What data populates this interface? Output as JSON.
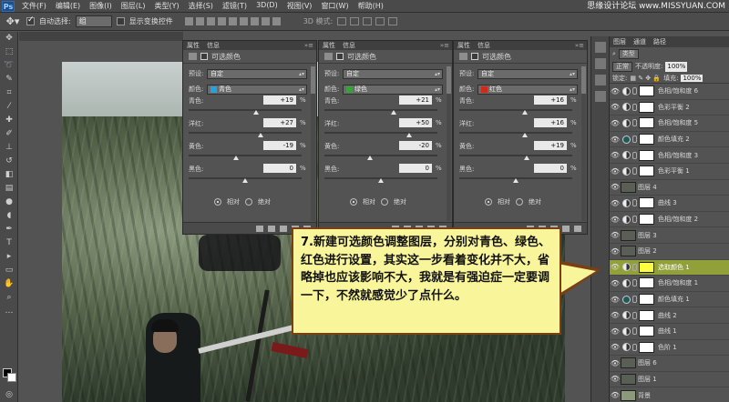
{
  "app": {
    "logo": "Ps",
    "menu": [
      "文件(F)",
      "编辑(E)",
      "图像(I)",
      "图层(L)",
      "类型(Y)",
      "选择(S)",
      "滤镜(T)",
      "3D(D)",
      "视图(V)",
      "窗口(W)",
      "帮助(H)"
    ],
    "watermark": "思缘设计论坛 www.MISSYUAN.COM"
  },
  "options": {
    "auto_select_label": "自动选择:",
    "auto_select_value": "组",
    "show_transform_label": "显示变换控件",
    "mode3d_label": "3D 模式:"
  },
  "panels": [
    {
      "tabs": [
        "属性",
        "信息"
      ],
      "title": "可选颜色",
      "preset_label": "预设:",
      "preset_value": "自定",
      "color_label": "颜色:",
      "color_value": "青色",
      "color_chip": "#27a0e0",
      "sliders": [
        {
          "label": "青色:",
          "value": "+19",
          "pos": 0.6
        },
        {
          "label": "洋红:",
          "value": "+27",
          "pos": 0.64
        },
        {
          "label": "黄色:",
          "value": "-19",
          "pos": 0.42
        },
        {
          "label": "黑色:",
          "value": "0",
          "pos": 0.5
        }
      ],
      "radio_relative": "相对",
      "radio_absolute": "绝对"
    },
    {
      "tabs": [
        "属性",
        "信息"
      ],
      "title": "可选颜色",
      "preset_label": "预设:",
      "preset_value": "自定",
      "color_label": "颜色:",
      "color_value": "绿色",
      "color_chip": "#3aa03a",
      "sliders": [
        {
          "label": "青色:",
          "value": "+21",
          "pos": 0.61
        },
        {
          "label": "洋红:",
          "value": "+50",
          "pos": 0.75
        },
        {
          "label": "黄色:",
          "value": "-20",
          "pos": 0.4
        },
        {
          "label": "黑色:",
          "value": "0",
          "pos": 0.5
        }
      ],
      "radio_relative": "相对",
      "radio_absolute": "绝对"
    },
    {
      "tabs": [
        "属性",
        "信息"
      ],
      "title": "可选颜色",
      "preset_label": "预设:",
      "preset_value": "自定",
      "color_label": "颜色:",
      "color_value": "红色",
      "color_chip": "#d12a1a",
      "sliders": [
        {
          "label": "青色:",
          "value": "+16",
          "pos": 0.58
        },
        {
          "label": "洋红:",
          "value": "+16",
          "pos": 0.58
        },
        {
          "label": "黄色:",
          "value": "+19",
          "pos": 0.6
        },
        {
          "label": "黑色:",
          "value": "0",
          "pos": 0.5
        }
      ],
      "radio_relative": "相对",
      "radio_absolute": "绝对"
    }
  ],
  "layers_panel": {
    "tabs": [
      "图层",
      "通道",
      "路径"
    ],
    "filter_label": "类型",
    "blend_mode": "正常",
    "opacity_label": "不透明度:",
    "opacity_value": "100%",
    "lock_label": "锁定:",
    "fill_label": "填充:",
    "fill_value": "100%",
    "layers": [
      {
        "name": "色相/饱和度 6",
        "kind": "adj",
        "selected": false
      },
      {
        "name": "色彩平衡 2",
        "kind": "adj",
        "selected": false
      },
      {
        "name": "色相/饱和度 5",
        "kind": "adj",
        "selected": false
      },
      {
        "name": "颜色填充 2",
        "kind": "fill",
        "selected": false
      },
      {
        "name": "色相/饱和度 3",
        "kind": "adj",
        "selected": false
      },
      {
        "name": "色彩平衡 1",
        "kind": "adj",
        "selected": false
      },
      {
        "name": "图层 4",
        "kind": "pixel",
        "selected": false
      },
      {
        "name": "曲线 3",
        "kind": "adj",
        "selected": false
      },
      {
        "name": "色相/饱和度 2",
        "kind": "adj",
        "selected": false
      },
      {
        "name": "图层 3",
        "kind": "pixel",
        "selected": false
      },
      {
        "name": "图层 2",
        "kind": "pixel",
        "selected": false
      },
      {
        "name": "选取颜色 1",
        "kind": "adj",
        "selected": true
      },
      {
        "name": "色相/饱和度 1",
        "kind": "adj",
        "selected": false
      },
      {
        "name": "颜色填充 1",
        "kind": "fill",
        "selected": false
      },
      {
        "name": "曲线 2",
        "kind": "adj",
        "selected": false
      },
      {
        "name": "曲线 1",
        "kind": "adj",
        "selected": false
      },
      {
        "name": "色阶 1",
        "kind": "adj",
        "selected": false
      },
      {
        "name": "图层 6",
        "kind": "pixel",
        "selected": false
      },
      {
        "name": "图层 1",
        "kind": "pixel",
        "selected": false
      },
      {
        "name": "背景",
        "kind": "pixel",
        "selected": false
      }
    ]
  },
  "callout": {
    "text": "7.新建可选颜色调整图层，分别对青色、绿色、红色进行设置，其实这一步看着变化并不大，省略掉也应该影响不大，我就是有强迫症一定要调一下，不然就感觉少了点什么。"
  },
  "colors": {
    "callout_bg": "#f9f59a",
    "callout_border": "#7a3f12",
    "selected_layer": "#92a03a"
  }
}
